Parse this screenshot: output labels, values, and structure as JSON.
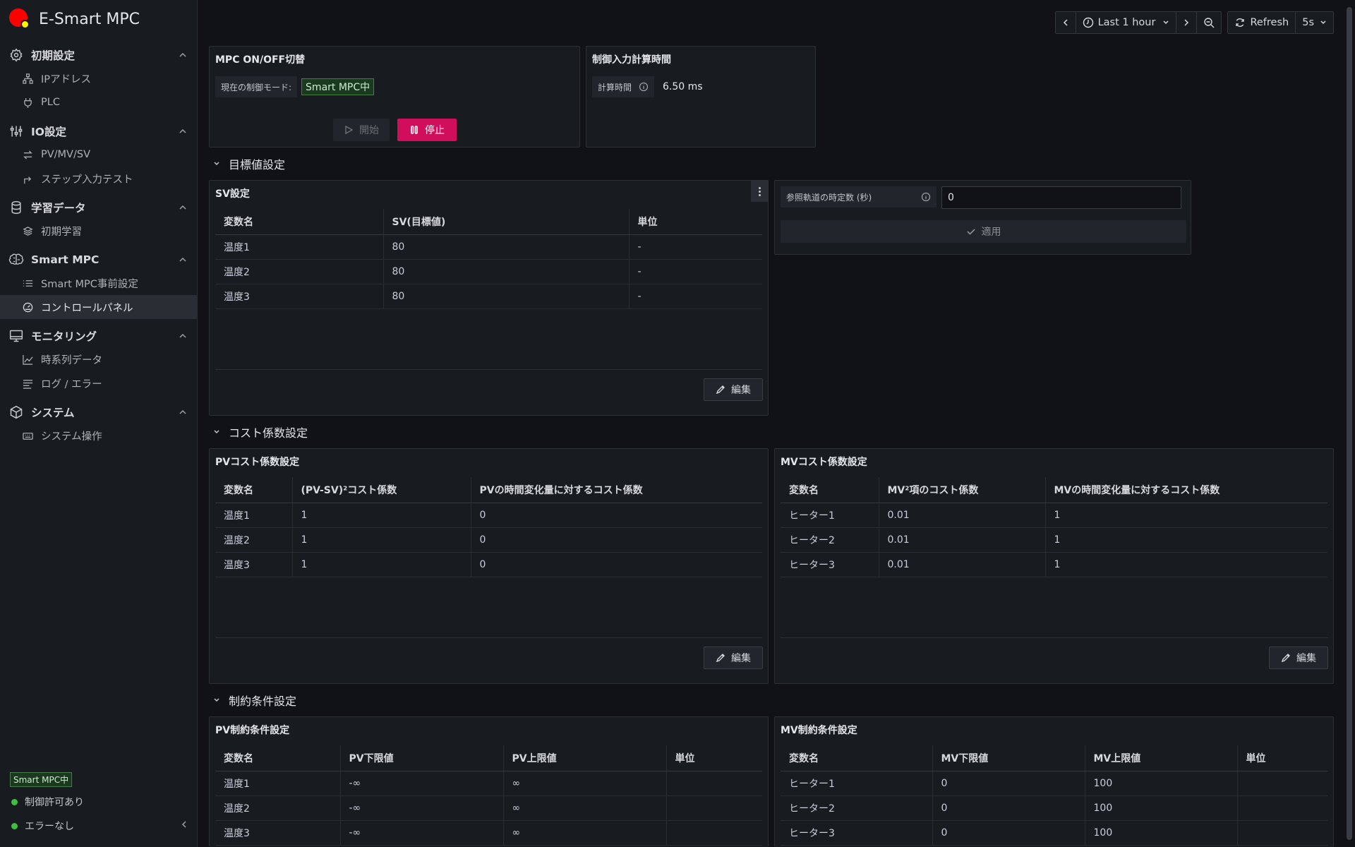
{
  "app": {
    "title": "E-Smart MPC"
  },
  "sidebar": {
    "sections": [
      {
        "label": "初期設定",
        "icon": "gear-icon",
        "items": [
          {
            "label": "IPアドレス",
            "icon": "network-icon"
          },
          {
            "label": "PLC",
            "icon": "plug-icon"
          }
        ]
      },
      {
        "label": "IO設定",
        "icon": "sliders-icon",
        "items": [
          {
            "label": "PV/MV/SV",
            "icon": "exchange-icon"
          },
          {
            "label": "ステップ入力テスト",
            "icon": "step-arrow-icon"
          }
        ]
      },
      {
        "label": "学習データ",
        "icon": "database-icon",
        "items": [
          {
            "label": "初期学習",
            "icon": "layers-icon"
          }
        ]
      },
      {
        "label": "Smart MPC",
        "icon": "brain-icon",
        "items": [
          {
            "label": "Smart MPC事前設定",
            "icon": "list-icon"
          },
          {
            "label": "コントロールパネル",
            "icon": "dashboard-icon"
          }
        ]
      },
      {
        "label": "モニタリング",
        "icon": "monitor-icon",
        "items": [
          {
            "label": "時系列データ",
            "icon": "line-chart-icon"
          },
          {
            "label": "ログ / エラー",
            "icon": "log-lines-icon"
          }
        ]
      },
      {
        "label": "システム",
        "icon": "cube-icon",
        "items": [
          {
            "label": "システム操作",
            "icon": "keyboard-icon"
          }
        ]
      }
    ],
    "active_item": "コントロールパネル",
    "badge": "Smart MPC中",
    "status": [
      "制御許可あり",
      "エラーなし"
    ]
  },
  "toolbar": {
    "time_range": "Last 1 hour",
    "refresh_label": "Refresh",
    "refresh_interval": "5s"
  },
  "mpc_panel": {
    "title": "MPC ON/OFF切替",
    "mode_label": "現在の制御モード:",
    "mode_value": "Smart MPC中",
    "start_label": "開始",
    "stop_label": "停止"
  },
  "calc_panel": {
    "title": "制御入力計算時間",
    "label": "計算時間",
    "value": "6.50 ms"
  },
  "rows": {
    "target": "目標値設定",
    "cost": "コスト係数設定",
    "constraint": "制約条件設定"
  },
  "sv_panel": {
    "title": "SV設定",
    "headers": [
      "変数名",
      "SV(目標値)",
      "単位"
    ],
    "rows": [
      [
        "温度1",
        "80",
        "-"
      ],
      [
        "温度2",
        "80",
        "-"
      ],
      [
        "温度3",
        "80",
        "-"
      ]
    ],
    "edit_label": "編集"
  },
  "ref_panel": {
    "label": "参照軌道の時定数 (秒)",
    "value": "0",
    "apply_label": "適用"
  },
  "pv_cost": {
    "title": "PVコスト係数設定",
    "headers": [
      "変数名",
      "(PV-SV)²コスト係数",
      "PVの時間変化量に対するコスト係数"
    ],
    "rows": [
      [
        "温度1",
        "1",
        "0"
      ],
      [
        "温度2",
        "1",
        "0"
      ],
      [
        "温度3",
        "1",
        "0"
      ]
    ],
    "edit_label": "編集"
  },
  "mv_cost": {
    "title": "MVコスト係数設定",
    "headers": [
      "変数名",
      "MV²項のコスト係数",
      "MVの時間変化量に対するコスト係数"
    ],
    "rows": [
      [
        "ヒーター1",
        "0.01",
        "1"
      ],
      [
        "ヒーター2",
        "0.01",
        "1"
      ],
      [
        "ヒーター3",
        "0.01",
        "1"
      ]
    ],
    "edit_label": "編集"
  },
  "pv_constraint": {
    "title": "PV制約条件設定",
    "headers": [
      "変数名",
      "PV下限値",
      "PV上限値",
      "単位"
    ],
    "rows": [
      [
        "温度1",
        "-∞",
        "∞",
        ""
      ],
      [
        "温度2",
        "-∞",
        "∞",
        ""
      ],
      [
        "温度3",
        "-∞",
        "∞",
        ""
      ]
    ]
  },
  "mv_constraint": {
    "title": "MV制約条件設定",
    "headers": [
      "変数名",
      "MV下限値",
      "MV上限値",
      "単位"
    ],
    "rows": [
      [
        "ヒーター1",
        "0",
        "100",
        ""
      ],
      [
        "ヒーター2",
        "0",
        "100",
        ""
      ],
      [
        "ヒーター3",
        "0",
        "100",
        ""
      ]
    ]
  }
}
